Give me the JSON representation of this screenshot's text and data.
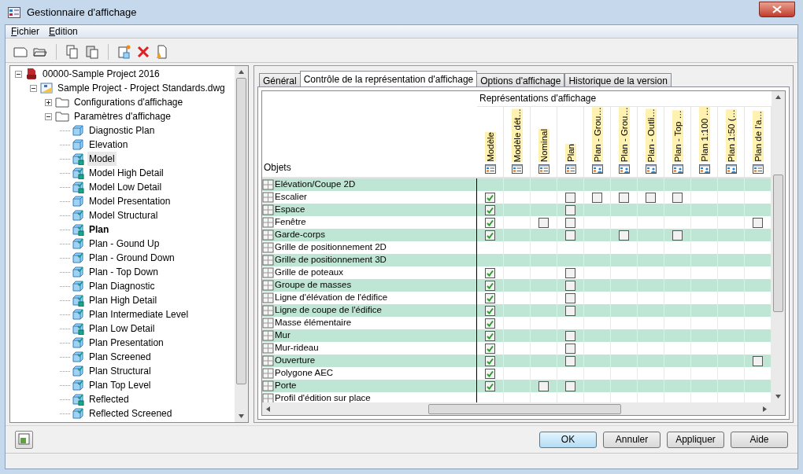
{
  "window": {
    "title": "Gestionnaire d'affichage"
  },
  "menu": [
    {
      "label": "Fichier"
    },
    {
      "label": "Edition"
    }
  ],
  "toolbar": [
    {
      "kind": "new"
    },
    {
      "kind": "open"
    },
    {
      "kind": "sep"
    },
    {
      "kind": "copy"
    },
    {
      "kind": "paste"
    },
    {
      "kind": "sep"
    },
    {
      "kind": "new-rep"
    },
    {
      "kind": "delete"
    },
    {
      "kind": "purge"
    }
  ],
  "tree": [
    {
      "label": "00000-Sample Project 2016",
      "kind": "project",
      "expanded": true,
      "children": [
        {
          "label": "Sample Project - Project Standards.dwg",
          "kind": "drawing",
          "expanded": true,
          "children": [
            {
              "label": "Configurations d'affichage",
              "kind": "folder",
              "expanded": false
            },
            {
              "label": "Paramètres d'affichage",
              "kind": "folder",
              "expanded": true,
              "children": [
                {
                  "label": "Diagnostic Plan",
                  "kind": "cube",
                  "selected": false,
                  "current": false
                },
                {
                  "label": "Elevation",
                  "kind": "cube",
                  "selected": false,
                  "current": false
                },
                {
                  "label": "Model",
                  "kind": "cube-check-square",
                  "selected": true,
                  "current": false
                },
                {
                  "label": "Model High Detail",
                  "kind": "cube-check-square",
                  "selected": false,
                  "current": false
                },
                {
                  "label": "Model Low Detail",
                  "kind": "cube-check-square",
                  "selected": false,
                  "current": false
                },
                {
                  "label": "Model Presentation",
                  "kind": "cube",
                  "selected": false,
                  "current": false
                },
                {
                  "label": "Model Structural",
                  "kind": "cube-check",
                  "selected": false,
                  "current": false
                },
                {
                  "label": "Plan",
                  "kind": "cube-check-square",
                  "selected": false,
                  "current": true
                },
                {
                  "label": "Plan - Gound Up",
                  "kind": "cube-check",
                  "selected": false,
                  "current": false
                },
                {
                  "label": "Plan - Ground Down",
                  "kind": "cube-check",
                  "selected": false,
                  "current": false
                },
                {
                  "label": "Plan - Top Down",
                  "kind": "cube-check",
                  "selected": false,
                  "current": false
                },
                {
                  "label": "Plan Diagnostic",
                  "kind": "cube-check",
                  "selected": false,
                  "current": false
                },
                {
                  "label": "Plan High Detail",
                  "kind": "cube-check-square",
                  "selected": false,
                  "current": false
                },
                {
                  "label": "Plan Intermediate Level",
                  "kind": "cube-check",
                  "selected": false,
                  "current": false
                },
                {
                  "label": "Plan Low Detail",
                  "kind": "cube-check-square",
                  "selected": false,
                  "current": false
                },
                {
                  "label": "Plan Presentation",
                  "kind": "cube-check",
                  "selected": false,
                  "current": false
                },
                {
                  "label": "Plan Screened",
                  "kind": "cube-check",
                  "selected": false,
                  "current": false
                },
                {
                  "label": "Plan Structural",
                  "kind": "cube-check",
                  "selected": false,
                  "current": false
                },
                {
                  "label": "Plan Top Level",
                  "kind": "cube-check",
                  "selected": false,
                  "current": false
                },
                {
                  "label": "Reflected",
                  "kind": "cube-check-square",
                  "selected": false,
                  "current": false
                },
                {
                  "label": "Reflected Screened",
                  "kind": "cube-check",
                  "selected": false,
                  "current": false
                }
              ]
            }
          ]
        }
      ]
    }
  ],
  "tabs": [
    {
      "label": "Général",
      "selected": false
    },
    {
      "label": "Contrôle de la représentation d'affichage",
      "selected": true
    },
    {
      "label": "Options d'affichage",
      "selected": false
    },
    {
      "label": "Historique de la version",
      "selected": false
    }
  ],
  "grid": {
    "objects_heading": "Objets",
    "group_heading": "Représentations d'affichage",
    "columns": [
      {
        "label": "Modèle",
        "kind": "plain"
      },
      {
        "label": "Modèle dét…",
        "kind": "plain"
      },
      {
        "label": "Nominal",
        "kind": "plain"
      },
      {
        "label": "Plan",
        "kind": "plain"
      },
      {
        "label": "Plan - Grou…",
        "kind": "person"
      },
      {
        "label": "Plan - Grou…",
        "kind": "person"
      },
      {
        "label": "Plan - Outli…",
        "kind": "person"
      },
      {
        "label": "Plan - Top …",
        "kind": "person"
      },
      {
        "label": "Plan 1:100 …",
        "kind": "person"
      },
      {
        "label": "Plan 1:50 (…",
        "kind": "person"
      },
      {
        "label": "Plan de l'a…",
        "kind": "plain"
      }
    ],
    "rows": [
      {
        "name": "Elévation/Coupe 2D",
        "cells": [
          {
            "kind": "blank"
          },
          {
            "kind": "blank"
          },
          {
            "kind": "blank"
          },
          {
            "kind": "blank"
          },
          {
            "kind": "blank"
          },
          {
            "kind": "blank"
          },
          {
            "kind": "blank"
          },
          {
            "kind": "blank"
          },
          {
            "kind": "blank"
          },
          {
            "kind": "blank"
          },
          {
            "kind": "blank"
          }
        ]
      },
      {
        "name": "Escalier",
        "cells": [
          {
            "kind": "checkbox",
            "checked": true
          },
          {
            "kind": "blank"
          },
          {
            "kind": "blank"
          },
          {
            "kind": "checkbox",
            "checked": false
          },
          {
            "kind": "checkbox",
            "checked": false
          },
          {
            "kind": "checkbox",
            "checked": false
          },
          {
            "kind": "checkbox",
            "checked": false
          },
          {
            "kind": "checkbox",
            "checked": false
          },
          {
            "kind": "blank"
          },
          {
            "kind": "blank"
          },
          {
            "kind": "blank"
          }
        ]
      },
      {
        "name": "Espace",
        "cells": [
          {
            "kind": "checkbox",
            "checked": true
          },
          {
            "kind": "blank"
          },
          {
            "kind": "blank"
          },
          {
            "kind": "checkbox",
            "checked": false
          },
          {
            "kind": "blank"
          },
          {
            "kind": "blank"
          },
          {
            "kind": "blank"
          },
          {
            "kind": "blank"
          },
          {
            "kind": "blank"
          },
          {
            "kind": "blank"
          },
          {
            "kind": "blank"
          }
        ]
      },
      {
        "name": "Fenêtre",
        "cells": [
          {
            "kind": "checkbox",
            "checked": true
          },
          {
            "kind": "blank"
          },
          {
            "kind": "checkbox",
            "checked": false
          },
          {
            "kind": "checkbox",
            "checked": false
          },
          {
            "kind": "blank"
          },
          {
            "kind": "blank"
          },
          {
            "kind": "blank"
          },
          {
            "kind": "blank"
          },
          {
            "kind": "blank"
          },
          {
            "kind": "blank"
          },
          {
            "kind": "checkbox",
            "checked": false
          }
        ]
      },
      {
        "name": "Garde-corps",
        "cells": [
          {
            "kind": "checkbox",
            "checked": true
          },
          {
            "kind": "blank"
          },
          {
            "kind": "blank"
          },
          {
            "kind": "checkbox",
            "checked": false
          },
          {
            "kind": "blank"
          },
          {
            "kind": "checkbox",
            "checked": false
          },
          {
            "kind": "blank"
          },
          {
            "kind": "checkbox",
            "checked": false
          },
          {
            "kind": "blank"
          },
          {
            "kind": "blank"
          },
          {
            "kind": "blank"
          }
        ]
      },
      {
        "name": "Grille de positionnement 2D",
        "cells": [
          {
            "kind": "blank"
          },
          {
            "kind": "blank"
          },
          {
            "kind": "blank"
          },
          {
            "kind": "blank"
          },
          {
            "kind": "blank"
          },
          {
            "kind": "blank"
          },
          {
            "kind": "blank"
          },
          {
            "kind": "blank"
          },
          {
            "kind": "blank"
          },
          {
            "kind": "blank"
          },
          {
            "kind": "blank"
          }
        ]
      },
      {
        "name": "Grille de positionnement 3D",
        "cells": [
          {
            "kind": "blank"
          },
          {
            "kind": "blank"
          },
          {
            "kind": "blank"
          },
          {
            "kind": "blank"
          },
          {
            "kind": "blank"
          },
          {
            "kind": "blank"
          },
          {
            "kind": "blank"
          },
          {
            "kind": "blank"
          },
          {
            "kind": "blank"
          },
          {
            "kind": "blank"
          },
          {
            "kind": "blank"
          }
        ]
      },
      {
        "name": "Grille de poteaux",
        "cells": [
          {
            "kind": "checkbox",
            "checked": true
          },
          {
            "kind": "blank"
          },
          {
            "kind": "blank"
          },
          {
            "kind": "checkbox",
            "checked": false
          },
          {
            "kind": "blank"
          },
          {
            "kind": "blank"
          },
          {
            "kind": "blank"
          },
          {
            "kind": "blank"
          },
          {
            "kind": "blank"
          },
          {
            "kind": "blank"
          },
          {
            "kind": "blank"
          }
        ]
      },
      {
        "name": "Groupe de masses",
        "cells": [
          {
            "kind": "checkbox",
            "checked": true
          },
          {
            "kind": "blank"
          },
          {
            "kind": "blank"
          },
          {
            "kind": "checkbox",
            "checked": false
          },
          {
            "kind": "blank"
          },
          {
            "kind": "blank"
          },
          {
            "kind": "blank"
          },
          {
            "kind": "blank"
          },
          {
            "kind": "blank"
          },
          {
            "kind": "blank"
          },
          {
            "kind": "blank"
          }
        ]
      },
      {
        "name": "Ligne d'élévation de l'édifice",
        "cells": [
          {
            "kind": "checkbox",
            "checked": true
          },
          {
            "kind": "blank"
          },
          {
            "kind": "blank"
          },
          {
            "kind": "checkbox",
            "checked": false
          },
          {
            "kind": "blank"
          },
          {
            "kind": "blank"
          },
          {
            "kind": "blank"
          },
          {
            "kind": "blank"
          },
          {
            "kind": "blank"
          },
          {
            "kind": "blank"
          },
          {
            "kind": "blank"
          }
        ]
      },
      {
        "name": "Ligne de coupe de l'édifice",
        "cells": [
          {
            "kind": "checkbox",
            "checked": true
          },
          {
            "kind": "blank"
          },
          {
            "kind": "blank"
          },
          {
            "kind": "checkbox",
            "checked": false
          },
          {
            "kind": "blank"
          },
          {
            "kind": "blank"
          },
          {
            "kind": "blank"
          },
          {
            "kind": "blank"
          },
          {
            "kind": "blank"
          },
          {
            "kind": "blank"
          },
          {
            "kind": "blank"
          }
        ]
      },
      {
        "name": "Masse élémentaire",
        "cells": [
          {
            "kind": "checkbox",
            "checked": true
          },
          {
            "kind": "blank"
          },
          {
            "kind": "blank"
          },
          {
            "kind": "blank"
          },
          {
            "kind": "blank"
          },
          {
            "kind": "blank"
          },
          {
            "kind": "blank"
          },
          {
            "kind": "blank"
          },
          {
            "kind": "blank"
          },
          {
            "kind": "blank"
          },
          {
            "kind": "blank"
          }
        ]
      },
      {
        "name": "Mur",
        "cells": [
          {
            "kind": "checkbox",
            "checked": true
          },
          {
            "kind": "blank"
          },
          {
            "kind": "blank"
          },
          {
            "kind": "checkbox",
            "checked": false
          },
          {
            "kind": "blank"
          },
          {
            "kind": "blank"
          },
          {
            "kind": "blank"
          },
          {
            "kind": "blank"
          },
          {
            "kind": "blank"
          },
          {
            "kind": "blank"
          },
          {
            "kind": "blank"
          }
        ]
      },
      {
        "name": "Mur-rideau",
        "cells": [
          {
            "kind": "checkbox",
            "checked": true
          },
          {
            "kind": "blank"
          },
          {
            "kind": "blank"
          },
          {
            "kind": "checkbox",
            "checked": false
          },
          {
            "kind": "blank"
          },
          {
            "kind": "blank"
          },
          {
            "kind": "blank"
          },
          {
            "kind": "blank"
          },
          {
            "kind": "blank"
          },
          {
            "kind": "blank"
          },
          {
            "kind": "blank"
          }
        ]
      },
      {
        "name": "Ouverture",
        "cells": [
          {
            "kind": "checkbox",
            "checked": true
          },
          {
            "kind": "blank"
          },
          {
            "kind": "blank"
          },
          {
            "kind": "checkbox",
            "checked": false
          },
          {
            "kind": "blank"
          },
          {
            "kind": "blank"
          },
          {
            "kind": "blank"
          },
          {
            "kind": "blank"
          },
          {
            "kind": "blank"
          },
          {
            "kind": "blank"
          },
          {
            "kind": "checkbox",
            "checked": false
          }
        ]
      },
      {
        "name": "Polygone AEC",
        "cells": [
          {
            "kind": "checkbox",
            "checked": true
          },
          {
            "kind": "blank"
          },
          {
            "kind": "blank"
          },
          {
            "kind": "blank"
          },
          {
            "kind": "blank"
          },
          {
            "kind": "blank"
          },
          {
            "kind": "blank"
          },
          {
            "kind": "blank"
          },
          {
            "kind": "blank"
          },
          {
            "kind": "blank"
          },
          {
            "kind": "blank"
          }
        ]
      },
      {
        "name": "Porte",
        "cells": [
          {
            "kind": "checkbox",
            "checked": true
          },
          {
            "kind": "blank"
          },
          {
            "kind": "checkbox",
            "checked": false
          },
          {
            "kind": "checkbox",
            "checked": false
          },
          {
            "kind": "blank"
          },
          {
            "kind": "blank"
          },
          {
            "kind": "blank"
          },
          {
            "kind": "blank"
          },
          {
            "kind": "blank"
          },
          {
            "kind": "blank"
          },
          {
            "kind": "blank"
          }
        ]
      },
      {
        "name": "Profil d'édition sur place",
        "cells": [
          {
            "kind": "blank"
          },
          {
            "kind": "blank"
          },
          {
            "kind": "blank"
          },
          {
            "kind": "blank"
          },
          {
            "kind": "blank"
          },
          {
            "kind": "blank"
          },
          {
            "kind": "blank"
          },
          {
            "kind": "blank"
          },
          {
            "kind": "blank"
          },
          {
            "kind": "blank"
          },
          {
            "kind": "blank"
          }
        ]
      }
    ]
  },
  "buttons": [
    {
      "label": "OK",
      "default": true
    },
    {
      "label": "Annuler",
      "default": false
    },
    {
      "label": "Appliquer",
      "default": false
    },
    {
      "label": "Aide",
      "default": false
    }
  ]
}
